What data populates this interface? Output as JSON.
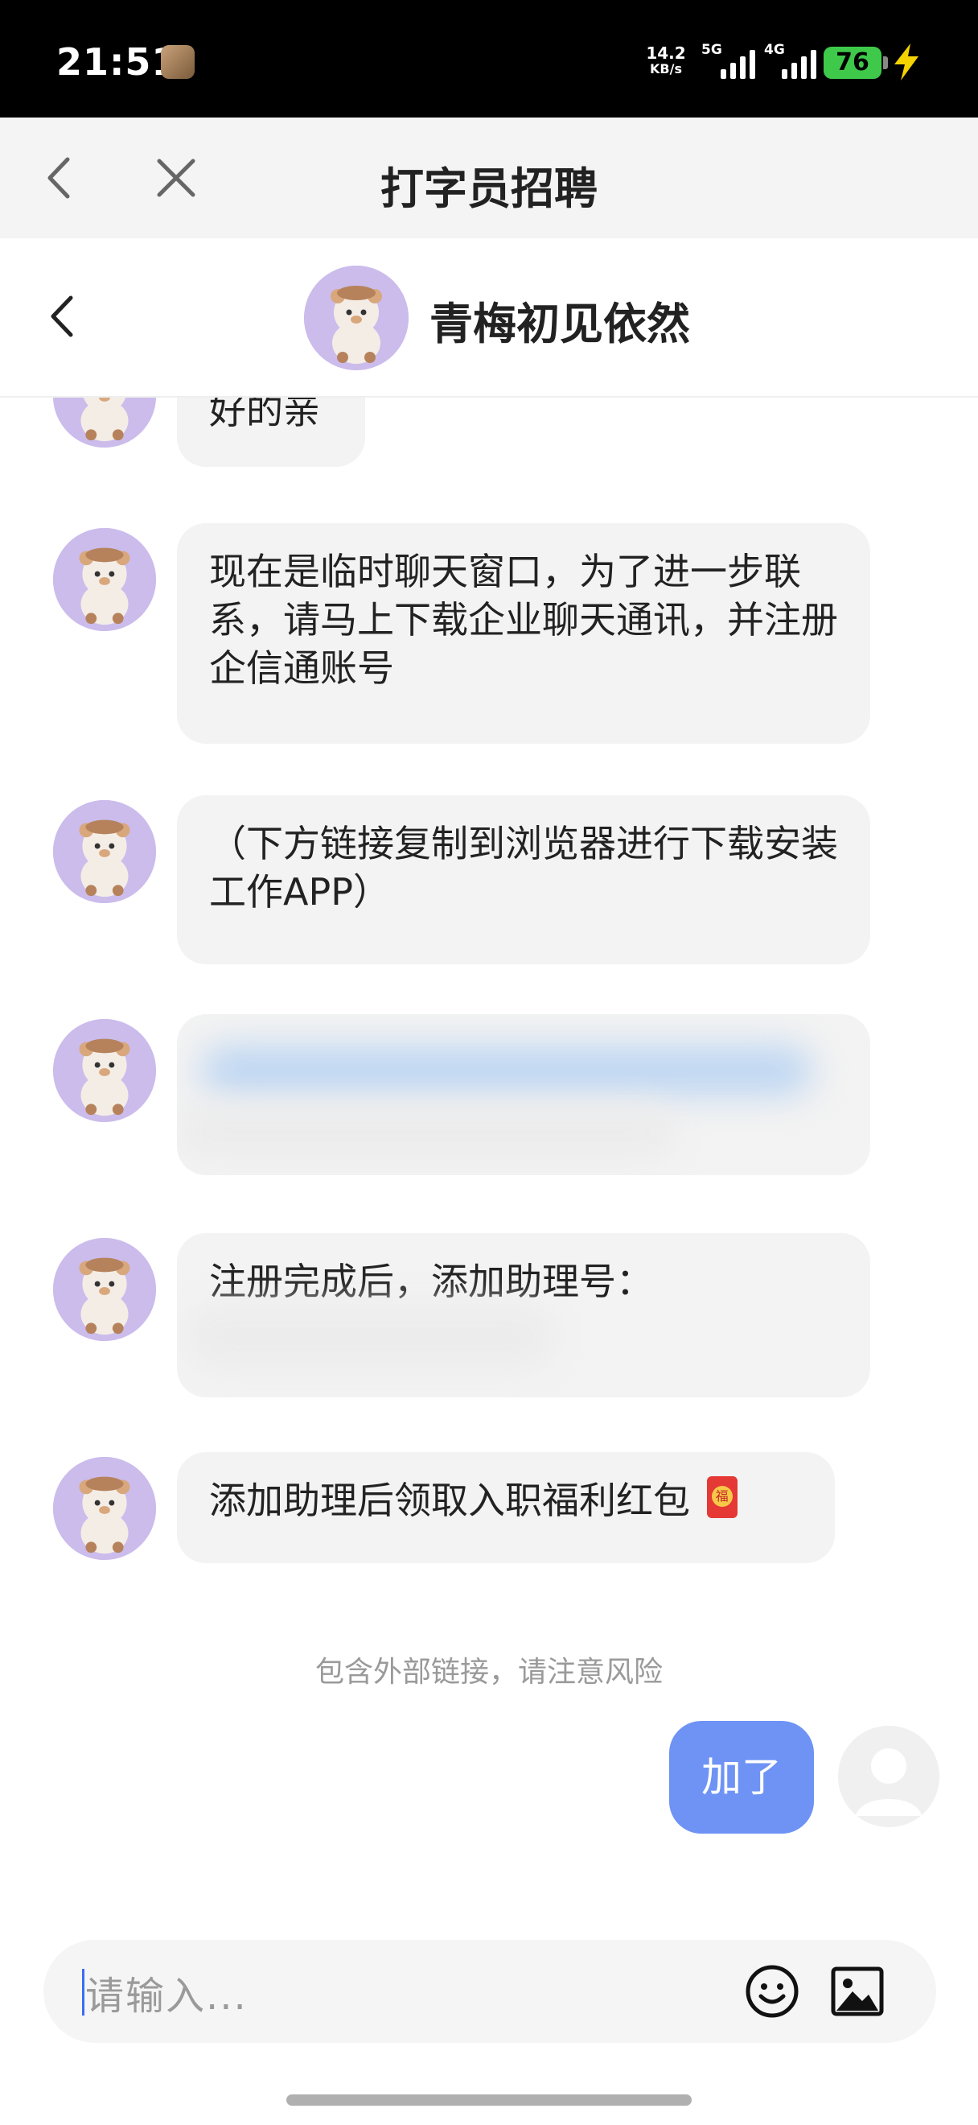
{
  "status_bar": {
    "time": "21:51",
    "net_speed_value": "14.2",
    "net_speed_unit": "KB/s",
    "sim1_type": "5G",
    "sim2_type": "4G",
    "battery": "76"
  },
  "web_bar": {
    "title": "打字员招聘"
  },
  "chat_header": {
    "contact_name": "青梅初见依然"
  },
  "messages": [
    {
      "text": "好的亲"
    },
    {
      "text": "现在是临时聊天窗口，为了进一步联系，请马上下载企业聊天通讯，并注册企信通账号"
    },
    {
      "text": "（下方链接复制到浏览器进行下载安装工作APP）"
    },
    {
      "text": ""
    },
    {
      "text": "注册完成后，添加助理号："
    },
    {
      "text": "添加助理后领取入职福利红包"
    }
  ],
  "red_packet_char": "福",
  "notice": "包含外部链接，请注意风险",
  "my_message": "加了",
  "input": {
    "placeholder": "请输入..."
  },
  "colors": {
    "accent": "#6e93f5",
    "battery": "#3ec94a",
    "bolt": "#f5d300",
    "avatar_bg": "#cbbcec"
  }
}
